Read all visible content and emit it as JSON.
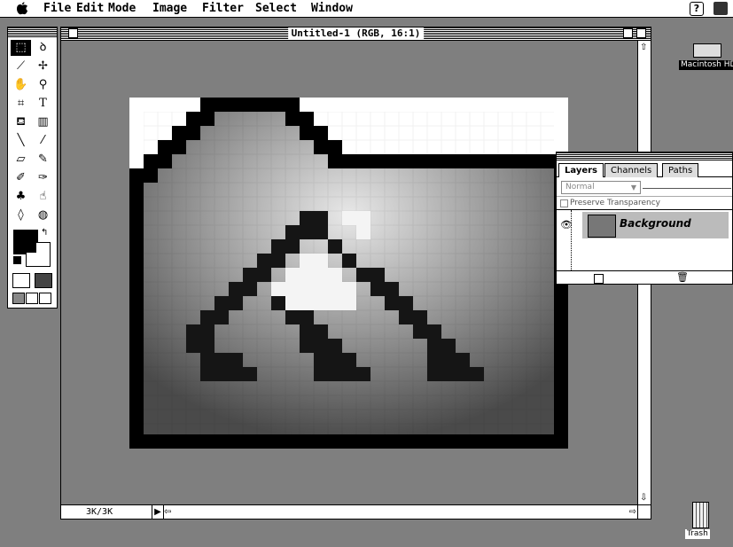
{
  "menubar": {
    "apple": "",
    "items": [
      "File",
      "Edit",
      "Mode",
      "Image",
      "Filter",
      "Select",
      "Window"
    ]
  },
  "document": {
    "title": "Untitled-1 (RGB, 16:1)",
    "status": "3K/3K"
  },
  "layers_palette": {
    "tabs": [
      "Layers",
      "Channels",
      "Paths"
    ],
    "active_tab": "Layers",
    "blend_mode": "Normal",
    "preserve_transparency_label": "Preserve Transparency",
    "preserve_transparency_checked": false,
    "layer_name": "Background"
  },
  "desktop": {
    "hd_label": "Macintosh HD",
    "trash_label": "Trash"
  },
  "colors": {
    "desktop": "#7f7f7f",
    "foreground_color": "#000000",
    "background_color": "#ffffff"
  }
}
